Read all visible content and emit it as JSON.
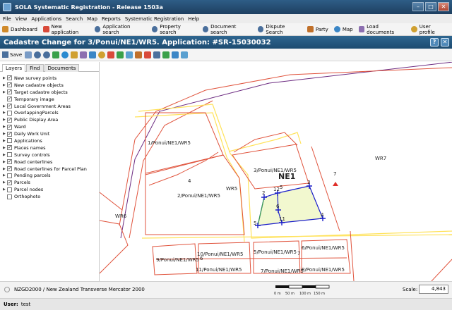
{
  "window": {
    "title": "SOLA Systematic Registration - Release 1503a"
  },
  "menu": [
    "File",
    "View",
    "Applications",
    "Search",
    "Map",
    "Reports",
    "Systematic Registration",
    "Help"
  ],
  "toolbar": [
    {
      "label": "Dashboard",
      "icon": "home-icon",
      "color": "#d08a2a"
    },
    {
      "label": "New application",
      "icon": "new-application-icon",
      "color": "#d94a3a"
    },
    {
      "label": "Application search",
      "icon": "search-icon",
      "color": "#4a6f9c"
    },
    {
      "label": "Property search",
      "icon": "search-icon",
      "color": "#4a6f9c"
    },
    {
      "label": "Document search",
      "icon": "search-icon",
      "color": "#4a6f9c"
    },
    {
      "label": "Dispute Search",
      "icon": "search-icon",
      "color": "#4a6f9c"
    },
    {
      "label": "Party",
      "icon": "party-icon",
      "color": "#c0702a"
    },
    {
      "label": "Map",
      "icon": "map-icon",
      "color": "#3b86c6"
    },
    {
      "label": "Load documents",
      "icon": "load-documents-icon",
      "color": "#8c6fb0"
    },
    {
      "label": "User profile",
      "icon": "user-icon",
      "color": "#d0a030"
    }
  ],
  "page": {
    "title": "Cadastre Change for 3/Ponui/NE1/WR5. Application: #SR-15030032"
  },
  "maptools": {
    "save_label": "Save"
  },
  "tabs": [
    "Layers",
    "Find",
    "Documents"
  ],
  "layers": [
    {
      "label": "New survey points",
      "checked": true,
      "expandable": true
    },
    {
      "label": "New cadastre objects",
      "checked": true,
      "expandable": true
    },
    {
      "label": "Target cadastre objects",
      "checked": true,
      "expandable": true
    },
    {
      "label": "Temporary image",
      "checked": true,
      "expandable": false
    },
    {
      "label": "Local Government Areas",
      "checked": true,
      "expandable": true
    },
    {
      "label": "OverlappingParcels",
      "checked": false,
      "expandable": true
    },
    {
      "label": "Public Display Area",
      "checked": true,
      "expandable": true
    },
    {
      "label": "Ward",
      "checked": true,
      "expandable": true
    },
    {
      "label": "Daily Work Unit",
      "checked": true,
      "expandable": true
    },
    {
      "label": "Applications",
      "checked": false,
      "expandable": true
    },
    {
      "label": "Places names",
      "checked": true,
      "expandable": true
    },
    {
      "label": "Survey controls",
      "checked": false,
      "expandable": true
    },
    {
      "label": "Road centerlines",
      "checked": true,
      "expandable": true
    },
    {
      "label": "Road centerlines for Parcel Plan",
      "checked": true,
      "expandable": true
    },
    {
      "label": "Pending parcels",
      "checked": false,
      "expandable": true
    },
    {
      "label": "Parcels",
      "checked": true,
      "expandable": true
    },
    {
      "label": "Parcel nodes",
      "checked": false,
      "expandable": true
    },
    {
      "label": "Orthophoto",
      "checked": false,
      "expandable": false
    }
  ],
  "map": {
    "parcel_labels": [
      "1/Ponui/NE1/WR5",
      "4",
      "2/Ponui/NE1/WR5",
      "WR5",
      "3/Ponui/NE1/WR5",
      "NE1",
      "WR7",
      "WR6",
      "10/Ponui/NE1/WR5",
      "9/Ponui/NE1/WR5",
      "6",
      "5/Ponui/NE1/WR5",
      "6/Ponui/NE1/WR5",
      "11/Ponui/NE1/WR5",
      "7/Ponui/NE1/WR5",
      "8/Ponui/NE1/WR5",
      "7"
    ],
    "node_labels": [
      "2",
      "12",
      "5",
      "3",
      "6",
      "5",
      "11",
      "4"
    ],
    "marker_label": "7",
    "colors": {
      "parcel": "#e0533c",
      "ward": "#ffe25a",
      "boundary": "#6b2a80",
      "node": "#1b1fc9",
      "new_parcel_fill": "#f2f8cf"
    }
  },
  "status": {
    "crs": "NZGD2000 / New Zealand Transverse Mercator 2000",
    "scale_ticks": [
      "0 m",
      "50 m",
      "100 m",
      "150 m"
    ],
    "scale_label": "Scale:",
    "scale_value": "4,843"
  },
  "user": {
    "label": "User:",
    "name": "test"
  }
}
